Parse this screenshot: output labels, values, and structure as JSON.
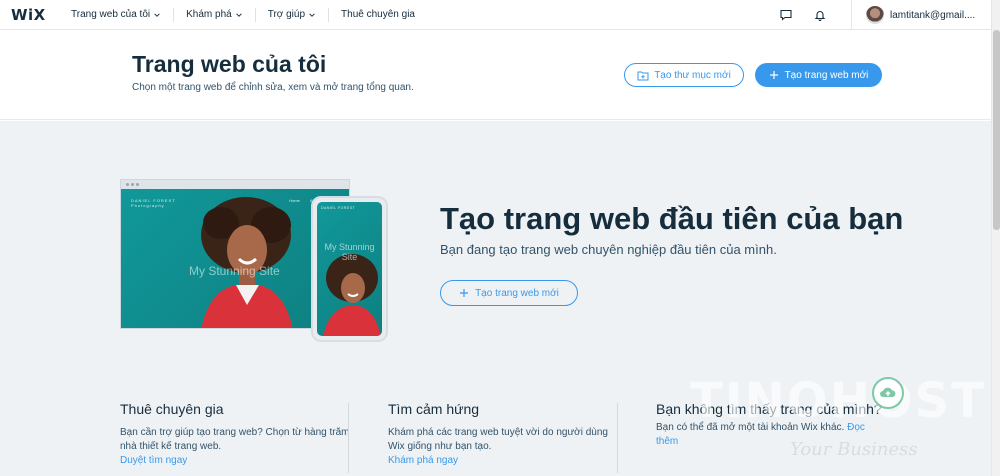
{
  "topbar": {
    "logo": "WiX",
    "nav": [
      {
        "label": "Trang web của tôi",
        "dropdown": true
      },
      {
        "label": "Khám phá",
        "dropdown": true
      },
      {
        "label": "Trợ giúp",
        "dropdown": true
      },
      {
        "label": "Thuê chuyên gia",
        "dropdown": false
      }
    ],
    "email": "lamtitank@gmail...."
  },
  "header": {
    "title": "Trang web của tôi",
    "subtitle": "Chọn một trang web để chỉnh sửa, xem và mở trang tổng quan.",
    "new_folder_label": "Tạo thư mục mới",
    "new_site_label": "Tạo trang web mới"
  },
  "hero": {
    "preview_desktop_text": "My Stunning Site",
    "preview_brand": "DANIEL FOREST",
    "preview_brand_sub": "Photography",
    "preview_phone_text": "My Stunning Site",
    "title": "Tạo trang web đầu tiên của bạn",
    "subtitle": "Bạn đang tạo trang web chuyên nghiệp đầu tiên của mình.",
    "button_label": "Tạo trang web mới"
  },
  "columns": [
    {
      "title": "Thuê chuyên gia",
      "text": "Bạn cần trợ giúp tạo trang web? Chọn từ hàng trăm nhà thiết kế trang web.",
      "link": "Duyệt tìm ngay"
    },
    {
      "title": "Tìm cảm hứng",
      "text": "Khám phá các trang web tuyệt vời do người dùng Wix giống như bạn tạo.",
      "link": "Khám phá ngay"
    },
    {
      "title": "Bạn không tìm thấy trang của mình?",
      "text": "Bạn có thể đã mở một tài khoản Wix khác.",
      "link": "Đọc thêm"
    }
  ],
  "watermark": {
    "brand": "TINOHOST",
    "tagline": "Your Business"
  },
  "colors": {
    "accent": "#3899ec",
    "text_dark": "#162d3d",
    "bg_main": "#eff2f5",
    "teal": "#0f8d8c"
  }
}
